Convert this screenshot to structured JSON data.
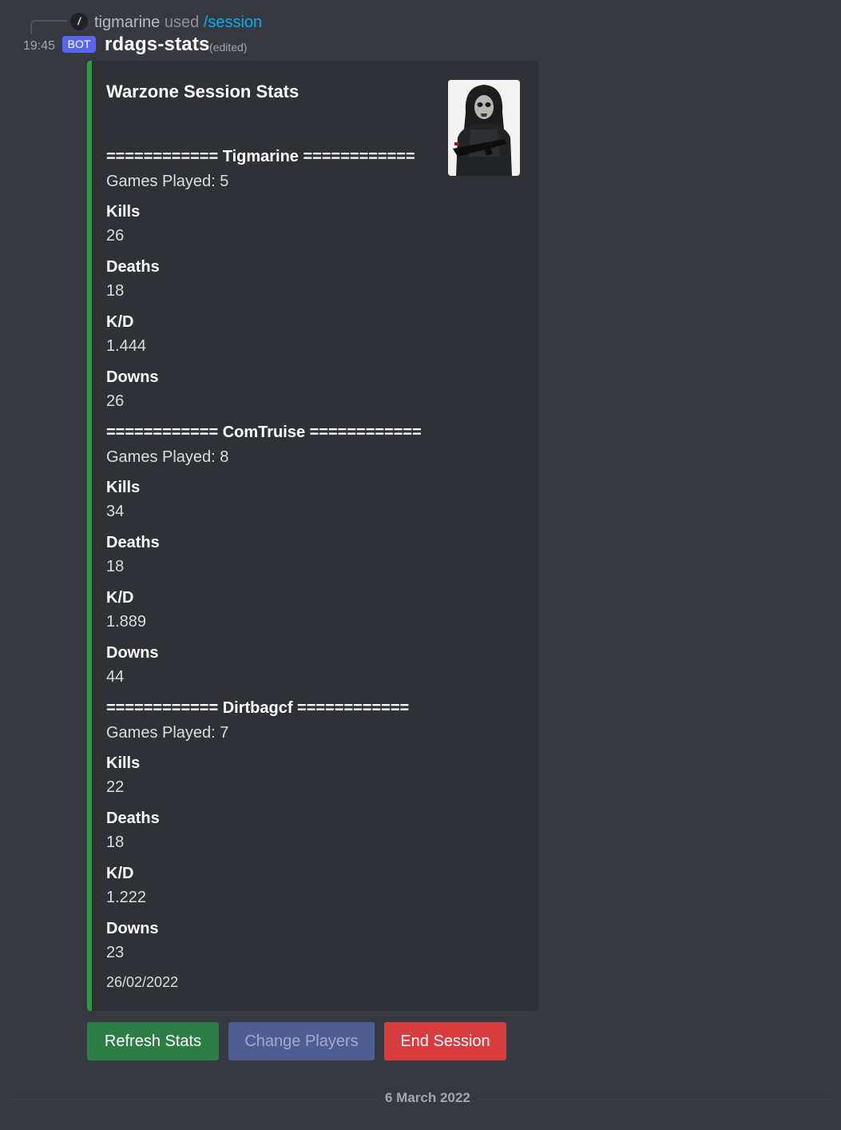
{
  "reply": {
    "user": "tigmarine",
    "used": "used",
    "command": "/session"
  },
  "header": {
    "timestamp": "19:45",
    "bot_tag": "BOT",
    "username": "rdags-stats",
    "edited": "(edited)"
  },
  "embed": {
    "title": "Warzone Session Stats",
    "accent_color": "#2d9a46",
    "players": [
      {
        "header": "============ Tigmarine ============",
        "games_played": "Games Played: 5",
        "fields": [
          {
            "name": "Kills",
            "value": "26"
          },
          {
            "name": "Deaths",
            "value": "18"
          },
          {
            "name": "K/D",
            "value": "1.444"
          },
          {
            "name": "Downs",
            "value": "26"
          }
        ]
      },
      {
        "header": "============ ComTruise ============",
        "games_played": "Games Played: 8",
        "fields": [
          {
            "name": "Kills",
            "value": "34"
          },
          {
            "name": "Deaths",
            "value": "18"
          },
          {
            "name": "K/D",
            "value": "1.889"
          },
          {
            "name": "Downs",
            "value": "44"
          }
        ]
      },
      {
        "header": "============ Dirtbagcf ============",
        "games_played": "Games Played: 7",
        "fields": [
          {
            "name": "Kills",
            "value": "22"
          },
          {
            "name": "Deaths",
            "value": "18"
          },
          {
            "name": "K/D",
            "value": "1.222"
          },
          {
            "name": "Downs",
            "value": "23"
          }
        ]
      }
    ],
    "footer": "26/02/2022"
  },
  "buttons": {
    "refresh": "Refresh Stats",
    "change": "Change Players",
    "end": "End Session"
  },
  "divider": {
    "date": "6 March 2022"
  }
}
